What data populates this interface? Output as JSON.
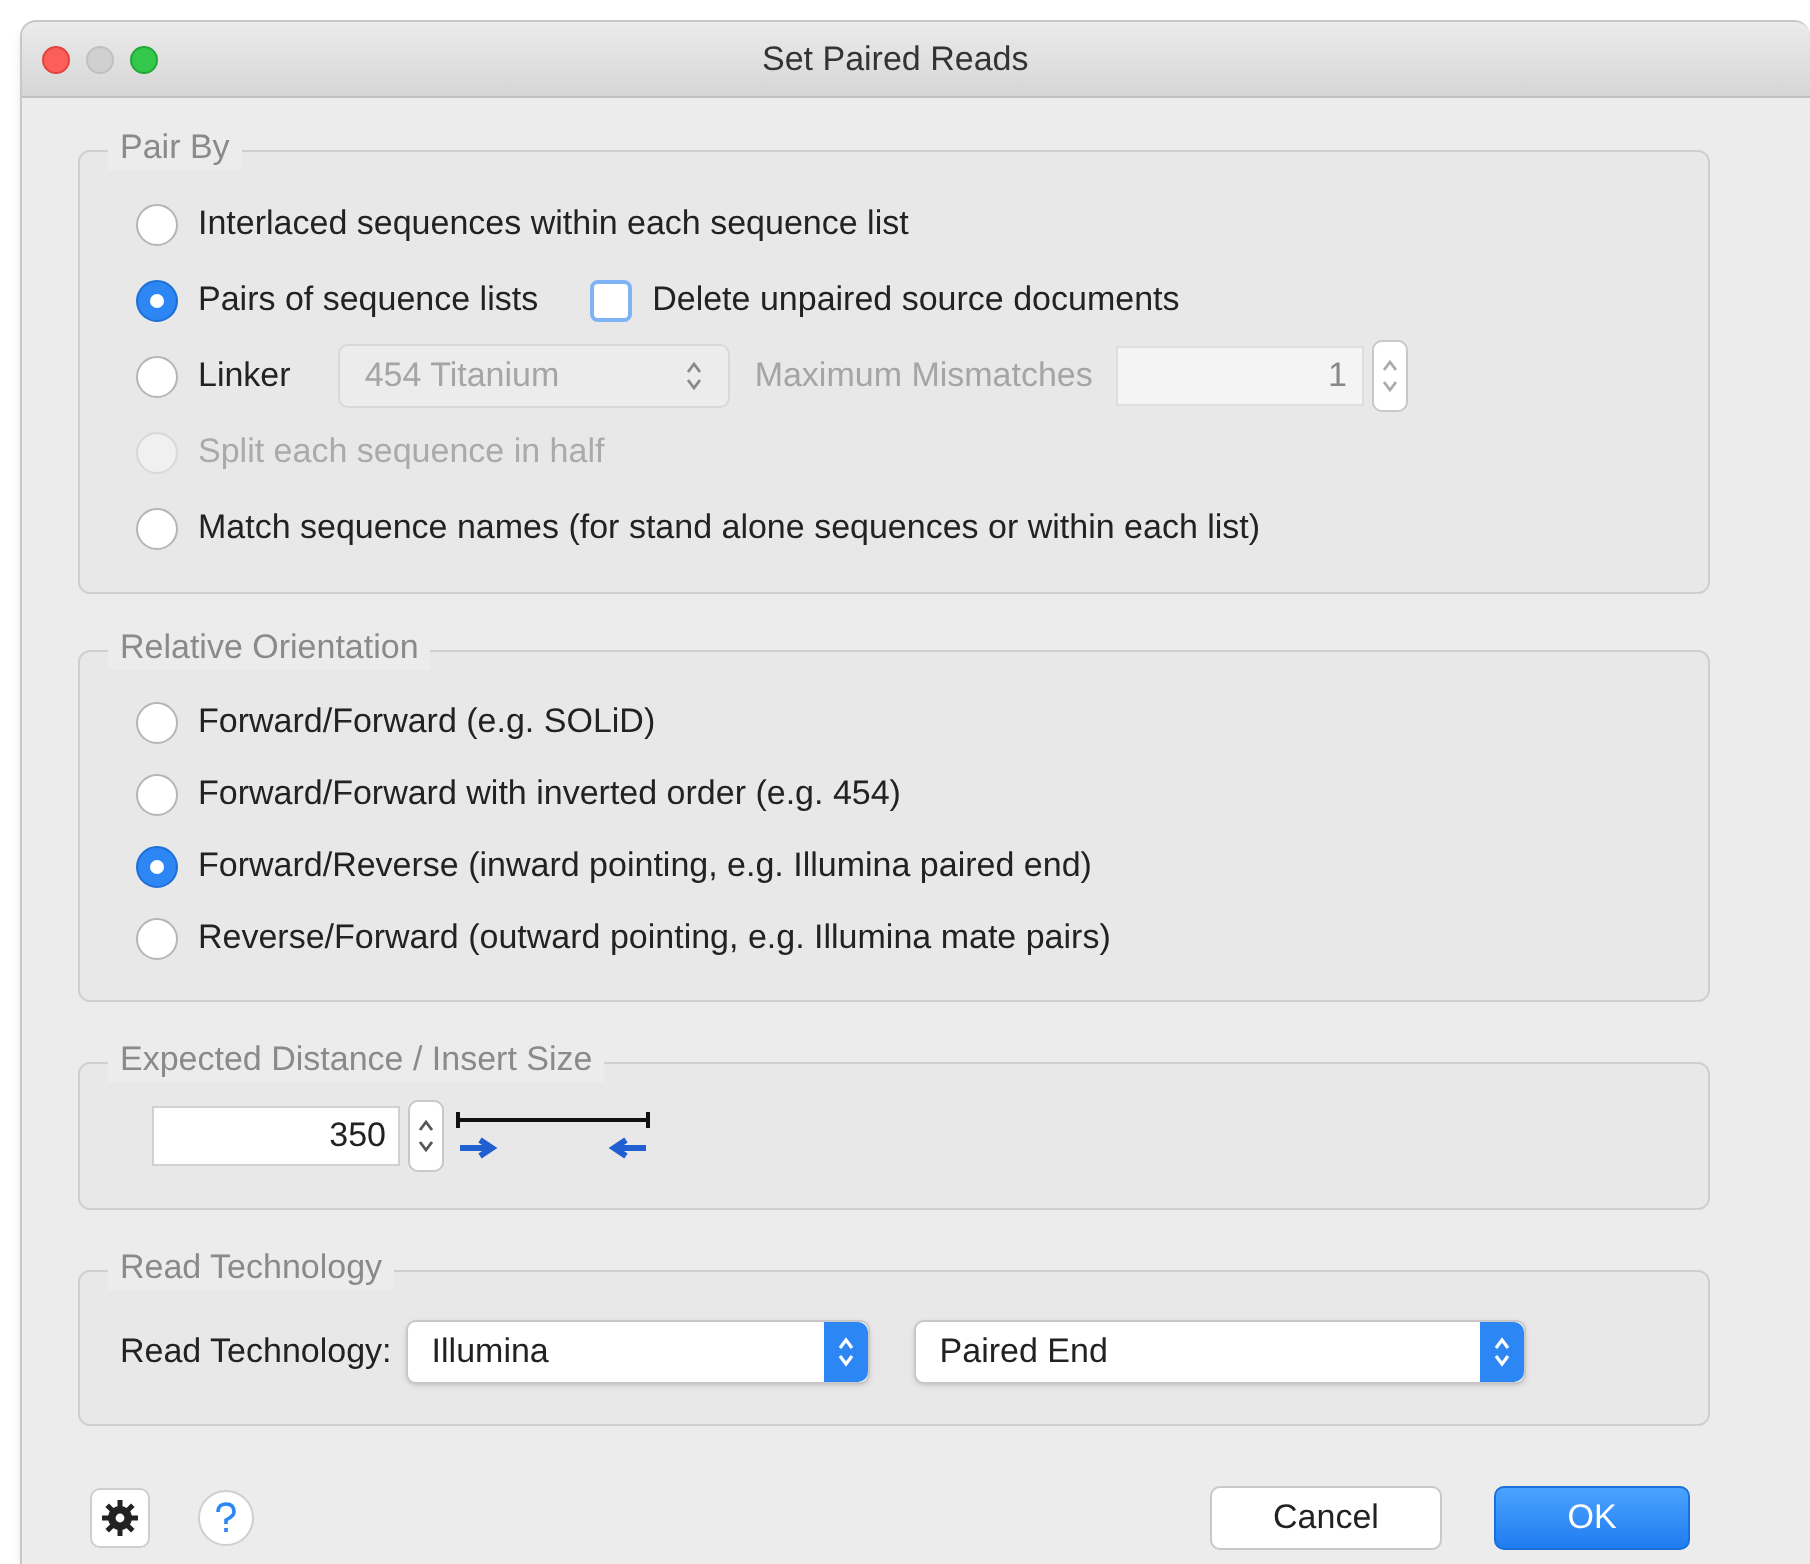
{
  "window": {
    "title": "Set Paired Reads"
  },
  "pair_by": {
    "title": "Pair By",
    "options": [
      {
        "kind": "plain",
        "label": "Interlaced sequences within each sequence list",
        "selected": false,
        "disabled": false
      },
      {
        "kind": "checkbox",
        "label": "Pairs of sequence lists",
        "selected": true,
        "disabled": false,
        "checkbox": {
          "label": "Delete unpaired source documents",
          "checked": false
        }
      },
      {
        "kind": "linker",
        "label": "Linker",
        "selected": false,
        "disabled": false,
        "linker": {
          "select": "454 Titanium",
          "mismatch_label": "Maximum Mismatches",
          "mismatch_value": "1",
          "disabled": true
        }
      },
      {
        "kind": "plain",
        "label": "Split each sequence in half",
        "selected": false,
        "disabled": true
      },
      {
        "kind": "plain",
        "label": "Match sequence names (for stand alone sequences or within each list)",
        "selected": false,
        "disabled": false
      }
    ]
  },
  "relative_orientation": {
    "title": "Relative Orientation",
    "options": [
      {
        "label": "Forward/Forward (e.g. SOLiD)",
        "selected": false
      },
      {
        "label": "Forward/Forward with inverted order (e.g. 454)",
        "selected": false
      },
      {
        "label": "Forward/Reverse (inward pointing, e.g. Illumina paired end)",
        "selected": true
      },
      {
        "label": "Reverse/Forward (outward pointing, e.g. Illumina mate pairs)",
        "selected": false
      }
    ]
  },
  "insert_size": {
    "title": "Expected Distance / Insert Size",
    "value": "350"
  },
  "read_technology": {
    "title": "Read Technology",
    "label": "Read Technology:",
    "technology": "Illumina",
    "mode": "Paired End"
  },
  "buttons": [
    {
      "label": "Cancel",
      "kind": "secondary"
    },
    {
      "label": "OK",
      "kind": "primary"
    }
  ]
}
